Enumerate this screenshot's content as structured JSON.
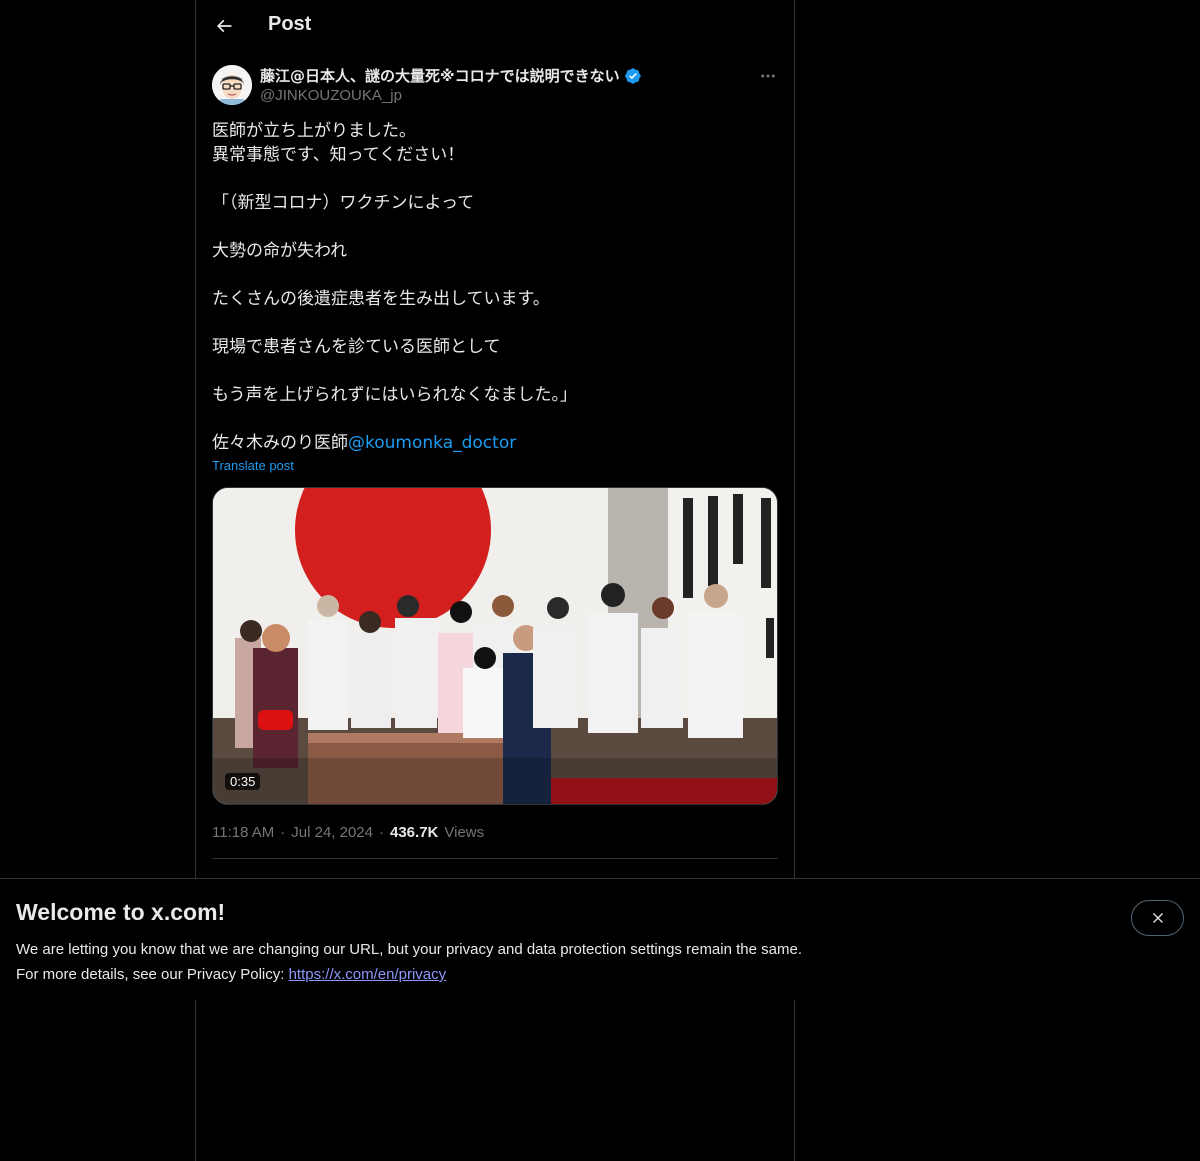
{
  "header": {
    "title": "Post"
  },
  "author": {
    "display_name": "藤江@日本人、謎の大量死※コロナでは説明できない",
    "handle": "@JINKOUZOUKA_jp",
    "verified": true
  },
  "post": {
    "lines": [
      "医師が立ち上がりました。",
      "異常事態です、知ってください！",
      "",
      "「（新型コロナ）ワクチンによって",
      "",
      "大勢の命が失われ",
      "",
      "たくさんの後遺症患者を生み出しています。",
      "",
      "現場で患者さんを診ている医師として",
      "",
      "もう声を上げられずにはいられなくなました。」",
      ""
    ],
    "signature_prefix": "佐々木みのり医師",
    "mention": "@koumonka_doctor",
    "translate_label": "Translate post",
    "video_duration": "0:35",
    "time": "11:18 AM",
    "date": "Jul 24, 2024",
    "separator": "·",
    "views_count": "436.7K",
    "views_label": "Views"
  },
  "banner": {
    "title": "Welcome to x.com!",
    "line1": "We are letting you know that we are changing our URL, but your privacy and data protection settings remain the same.",
    "line2_prefix": "For more details, see our Privacy Policy: ",
    "link": "https://x.com/en/privacy"
  },
  "icons": {
    "back": "back-arrow-icon",
    "verified": "verified-badge-icon",
    "more": "more-horizontal-icon",
    "close": "close-icon"
  },
  "colors": {
    "background": "#000000",
    "text": "#e7e9ea",
    "secondary": "#71767b",
    "accent": "#1d9bf0",
    "border": "#2f3336",
    "link": "#8e98f9"
  }
}
